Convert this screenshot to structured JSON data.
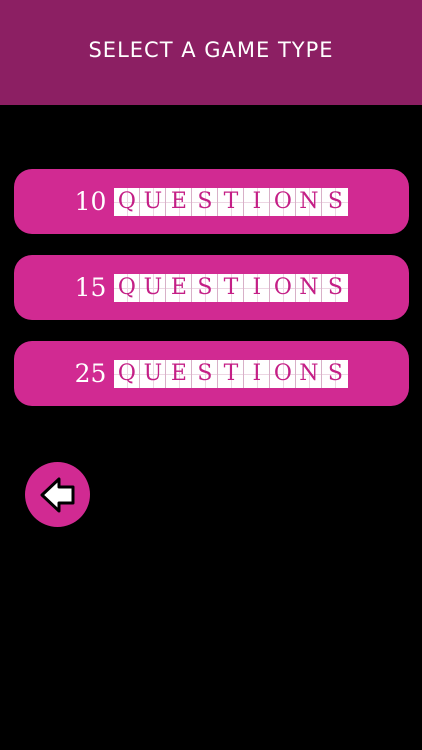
{
  "header": {
    "title": "SELECT A GAME TYPE"
  },
  "options": [
    {
      "number": "10",
      "label": "QUESTIONS",
      "letters": [
        "Q",
        "U",
        "E",
        "S",
        "T",
        "I",
        "O",
        "N",
        "S"
      ]
    },
    {
      "number": "15",
      "label": "QUESTIONS",
      "letters": [
        "Q",
        "U",
        "E",
        "S",
        "T",
        "I",
        "O",
        "N",
        "S"
      ]
    },
    {
      "number": "25",
      "label": "QUESTIONS",
      "letters": [
        "Q",
        "U",
        "E",
        "S",
        "T",
        "I",
        "O",
        "N",
        "S"
      ]
    }
  ],
  "back": {
    "icon": "arrow-left-icon"
  },
  "colors": {
    "header_bg": "#8c1f63",
    "button_bg": "#d12a92",
    "background": "#000000",
    "tile_text": "#c41f86"
  }
}
